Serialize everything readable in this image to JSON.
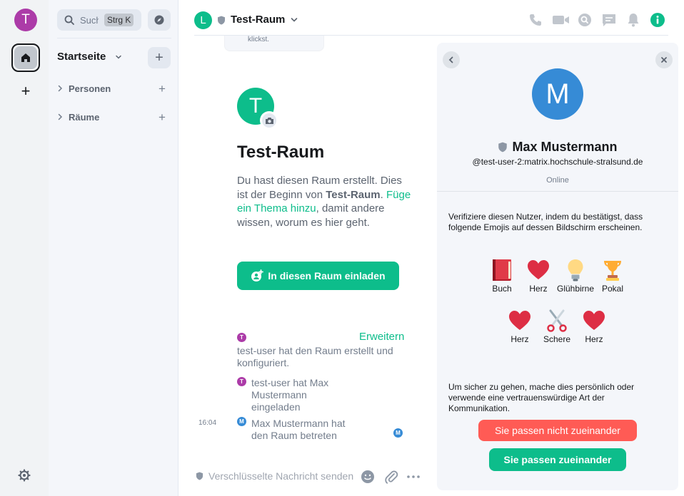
{
  "rail": {
    "user_initial": "T",
    "add_label": "+"
  },
  "room_list": {
    "search_label": "Suche",
    "search_shortcut": "Strg K",
    "title": "Startseite",
    "add_label": "+",
    "sections": [
      {
        "label": "Personen"
      },
      {
        "label": "Räume"
      }
    ]
  },
  "header": {
    "room_initial": "L",
    "room_name": "Test-Raum"
  },
  "timeline": {
    "previous_fragment": "klickst.",
    "room_initial": "T",
    "room_title": "Test-Raum",
    "intro_part1": "Du hast diesen Raum erstellt. Dies ist der Beginn von ",
    "intro_room": "Test-Raum",
    "intro_part2": ".",
    "intro_link": "Füge ein Thema hinzu",
    "intro_part3": ", damit andere wissen, worum es hier geht.",
    "invite_button": "In diesen Raum einladen",
    "expand_link": "Erweitern",
    "events": [
      {
        "avatar": "T",
        "text": "test-user hat den Raum erstellt und konfiguriert."
      },
      {
        "avatar": "T",
        "text": "test-user hat Max Mustermann eingeladen"
      },
      {
        "avatar": "M",
        "text": "Max Mustermann hat den Raum betreten",
        "time": "16:04",
        "receipt": "M"
      }
    ]
  },
  "composer": {
    "placeholder": "Verschlüsselte Nachricht senden…"
  },
  "verification": {
    "avatar_initial": "M",
    "name": "Max Mustermann",
    "mxid": "@test-user-2:matrix.hochschule-stralsund.de",
    "status": "Online",
    "instruction": "Verifiziere diesen Nutzer, indem du bestätigst, dass folgende Emojis auf dessen Bildschirm erscheinen.",
    "emojis": [
      {
        "icon": "book-icon",
        "label": "Buch"
      },
      {
        "icon": "heart-icon",
        "label": "Herz"
      },
      {
        "icon": "lightbulb-icon",
        "label": "Glühbirne"
      },
      {
        "icon": "trophy-icon",
        "label": "Pokal"
      },
      {
        "icon": "heart-icon",
        "label": "Herz"
      },
      {
        "icon": "scissors-icon",
        "label": "Schere"
      },
      {
        "icon": "heart-icon",
        "label": "Herz"
      }
    ],
    "advice": "Um sicher zu gehen, mache dies persönlich oder verwende eine vertrauenswürdige Art der Kommunikation.",
    "mismatch_button": "Sie passen nicht zueinander",
    "match_button": "Sie passen zueinander"
  },
  "colors": {
    "accent": "#0dbd8b",
    "danger": "#ff5b55",
    "user_t": "#ac3ba8",
    "user_m": "#368bd6"
  }
}
